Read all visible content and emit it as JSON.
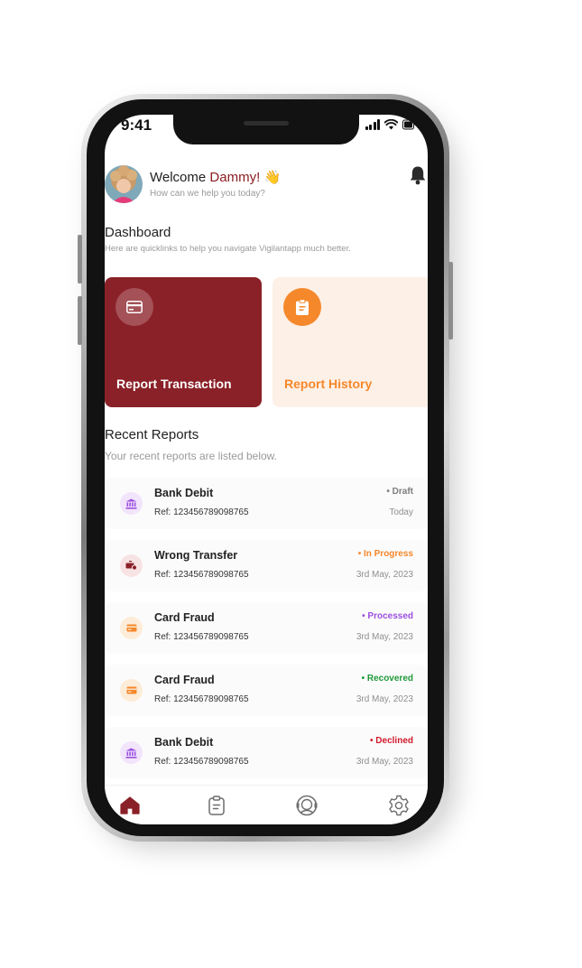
{
  "status_bar": {
    "time": "9:41"
  },
  "header": {
    "greeting": "Welcome",
    "user_name": "Dammy!",
    "wave_emoji": "👋",
    "subtitle": "How can we help you today?"
  },
  "dashboard": {
    "title": "Dashboard",
    "subtitle": "Here are quicklinks to help you navigate Vigilantapp much better."
  },
  "quick_links": [
    {
      "label": "Report Transaction",
      "icon": "card-icon",
      "bg": "#8b2128",
      "text_color": "#ffffff"
    },
    {
      "label": "Report History",
      "icon": "clipboard-icon",
      "bg": "#fdf0e6",
      "text_color": "#f5882b"
    }
  ],
  "recent": {
    "title": "Recent Reports",
    "subtitle": "Your recent reports are listed below.",
    "items": [
      {
        "title": "Bank Debit",
        "ref": "Ref: 123456789098765",
        "status": "• Draft",
        "date": "Today",
        "status_color": "#7d7d7d",
        "icon": "bank-icon"
      },
      {
        "title": "Wrong Transfer",
        "ref": "Ref: 123456789098765",
        "status": "• In Progress",
        "date": "3rd May, 2023",
        "status_color": "#f5882b",
        "icon": "transfer-icon"
      },
      {
        "title": "Card Fraud",
        "ref": "Ref: 123456789098765",
        "status": "• Processed",
        "date": "3rd May, 2023",
        "status_color": "#9b4fe0",
        "icon": "card-icon"
      },
      {
        "title": "Card Fraud",
        "ref": "Ref: 123456789098765",
        "status": "• Recovered",
        "date": "3rd May, 2023",
        "status_color": "#1f9a3a",
        "icon": "card-icon"
      },
      {
        "title": "Bank Debit",
        "ref": "Ref: 123456789098765",
        "status": "• Declined",
        "date": "3rd May, 2023",
        "status_color": "#d11a2a",
        "icon": "bank-icon"
      }
    ]
  },
  "bottom_nav": [
    {
      "icon": "home-icon",
      "active": true
    },
    {
      "icon": "clipboard-icon",
      "active": false
    },
    {
      "icon": "support-agent-icon",
      "active": false
    },
    {
      "icon": "settings-icon",
      "active": false
    }
  ],
  "colors": {
    "brand": "#8b2128",
    "accent_orange": "#f5882b",
    "muted_text": "#9a9a9a"
  }
}
